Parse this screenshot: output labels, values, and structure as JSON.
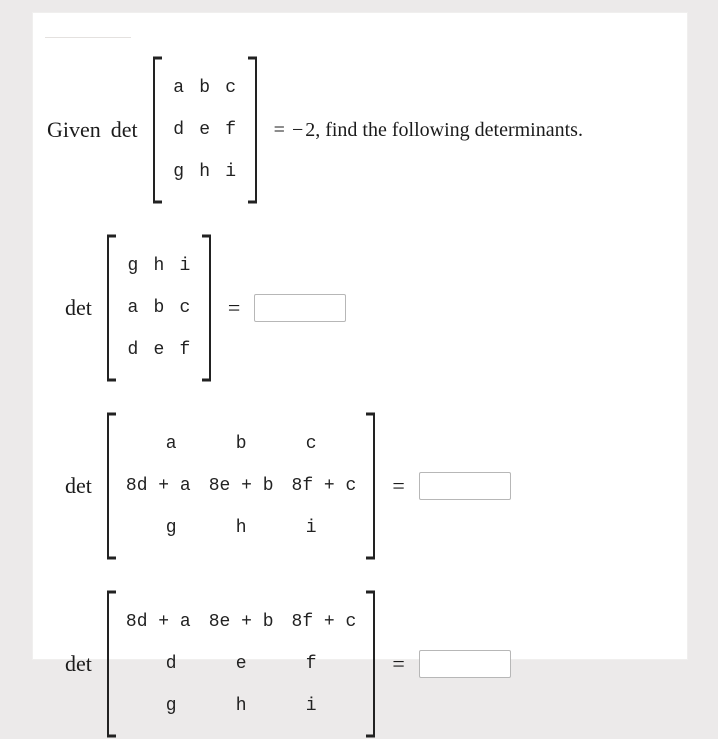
{
  "top_label": " ",
  "given": {
    "prefix": "Given",
    "det_label": "det",
    "matrix": [
      [
        "a",
        "b",
        "c"
      ],
      [
        "d",
        "e",
        "f"
      ],
      [
        "g",
        "h",
        "i"
      ]
    ],
    "equals": "=",
    "minus": "−",
    "value": "2",
    "suffix": ", find the following determinants."
  },
  "problems": [
    {
      "det_label": "det",
      "matrix": [
        [
          "g",
          "h",
          "i"
        ],
        [
          "a",
          "b",
          "c"
        ],
        [
          "d",
          "e",
          "f"
        ]
      ],
      "wide": false,
      "equals": "=",
      "answer": ""
    },
    {
      "det_label": "det",
      "matrix": [
        [
          "a",
          "b",
          "c"
        ],
        [
          "8d + a",
          "8e + b",
          "8f + c"
        ],
        [
          "g",
          "h",
          "i"
        ]
      ],
      "wide": true,
      "equals": "=",
      "answer": ""
    },
    {
      "det_label": "det",
      "matrix": [
        [
          "8d + a",
          "8e + b",
          "8f + c"
        ],
        [
          "d",
          "e",
          "f"
        ],
        [
          "g",
          "h",
          "i"
        ]
      ],
      "wide": true,
      "equals": "=",
      "answer": ""
    }
  ]
}
